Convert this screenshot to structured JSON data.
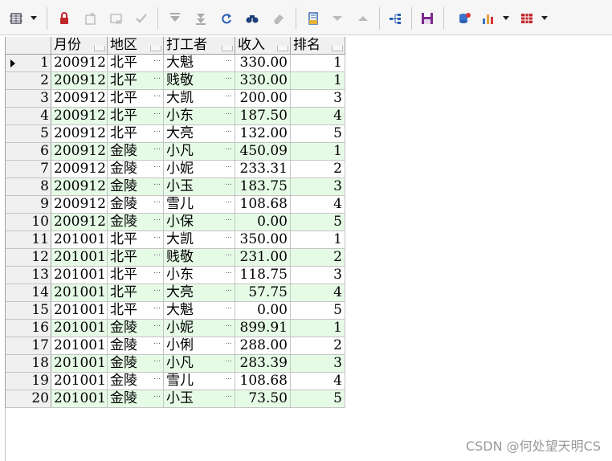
{
  "toolbar": {
    "items": [
      {
        "name": "grid-settings-icon",
        "dropdown": true
      },
      {
        "name": "lock-icon"
      },
      {
        "name": "new-record-icon"
      },
      {
        "name": "cancel-edit-icon"
      },
      {
        "name": "check-icon"
      },
      {
        "name": "filter-icon"
      },
      {
        "name": "sort-icon"
      },
      {
        "name": "refresh-icon"
      },
      {
        "name": "find-icon"
      },
      {
        "name": "eraser-icon"
      },
      {
        "name": "export-icon"
      },
      {
        "name": "move-down-icon"
      },
      {
        "name": "move-up-icon"
      },
      {
        "name": "tree-icon"
      },
      {
        "name": "save-icon"
      },
      {
        "name": "database-icon"
      },
      {
        "name": "chart-icon",
        "dropdown": true
      },
      {
        "name": "table-icon",
        "dropdown": true
      }
    ]
  },
  "grid": {
    "columns": [
      "月份",
      "地区",
      "打工者",
      "收入",
      "排名"
    ],
    "rows": [
      {
        "n": "1",
        "month": "200912",
        "region": "北平",
        "worker": "大魁",
        "income": "330.00",
        "rank": "1"
      },
      {
        "n": "2",
        "month": "200912",
        "region": "北平",
        "worker": "贱敬",
        "income": "330.00",
        "rank": "1"
      },
      {
        "n": "3",
        "month": "200912",
        "region": "北平",
        "worker": "大凯",
        "income": "200.00",
        "rank": "3"
      },
      {
        "n": "4",
        "month": "200912",
        "region": "北平",
        "worker": "小东",
        "income": "187.50",
        "rank": "4"
      },
      {
        "n": "5",
        "month": "200912",
        "region": "北平",
        "worker": "大亮",
        "income": "132.00",
        "rank": "5"
      },
      {
        "n": "6",
        "month": "200912",
        "region": "金陵",
        "worker": "小凡",
        "income": "450.09",
        "rank": "1"
      },
      {
        "n": "7",
        "month": "200912",
        "region": "金陵",
        "worker": "小妮",
        "income": "233.31",
        "rank": "2"
      },
      {
        "n": "8",
        "month": "200912",
        "region": "金陵",
        "worker": "小玉",
        "income": "183.75",
        "rank": "3"
      },
      {
        "n": "9",
        "month": "200912",
        "region": "金陵",
        "worker": "雪儿",
        "income": "108.68",
        "rank": "4"
      },
      {
        "n": "10",
        "month": "200912",
        "region": "金陵",
        "worker": "小保",
        "income": "0.00",
        "rank": "5"
      },
      {
        "n": "11",
        "month": "201001",
        "region": "北平",
        "worker": "大凯",
        "income": "350.00",
        "rank": "1"
      },
      {
        "n": "12",
        "month": "201001",
        "region": "北平",
        "worker": "贱敬",
        "income": "231.00",
        "rank": "2"
      },
      {
        "n": "13",
        "month": "201001",
        "region": "北平",
        "worker": "小东",
        "income": "118.75",
        "rank": "3"
      },
      {
        "n": "14",
        "month": "201001",
        "region": "北平",
        "worker": "大亮",
        "income": "57.75",
        "rank": "4"
      },
      {
        "n": "15",
        "month": "201001",
        "region": "北平",
        "worker": "大魁",
        "income": "0.00",
        "rank": "5"
      },
      {
        "n": "16",
        "month": "201001",
        "region": "金陵",
        "worker": "小妮",
        "income": "899.91",
        "rank": "1"
      },
      {
        "n": "17",
        "month": "201001",
        "region": "金陵",
        "worker": "小俐",
        "income": "288.00",
        "rank": "2"
      },
      {
        "n": "18",
        "month": "201001",
        "region": "金陵",
        "worker": "小凡",
        "income": "283.39",
        "rank": "3"
      },
      {
        "n": "19",
        "month": "201001",
        "region": "金陵",
        "worker": "雪儿",
        "income": "108.68",
        "rank": "4"
      },
      {
        "n": "20",
        "month": "201001",
        "region": "金陵",
        "worker": "小玉",
        "income": "73.50",
        "rank": "5"
      }
    ]
  },
  "watermark": "CSDN @何处望天明CS",
  "colors": {
    "alt_row": "#e6fbe6",
    "header": "#f0f0f0"
  }
}
